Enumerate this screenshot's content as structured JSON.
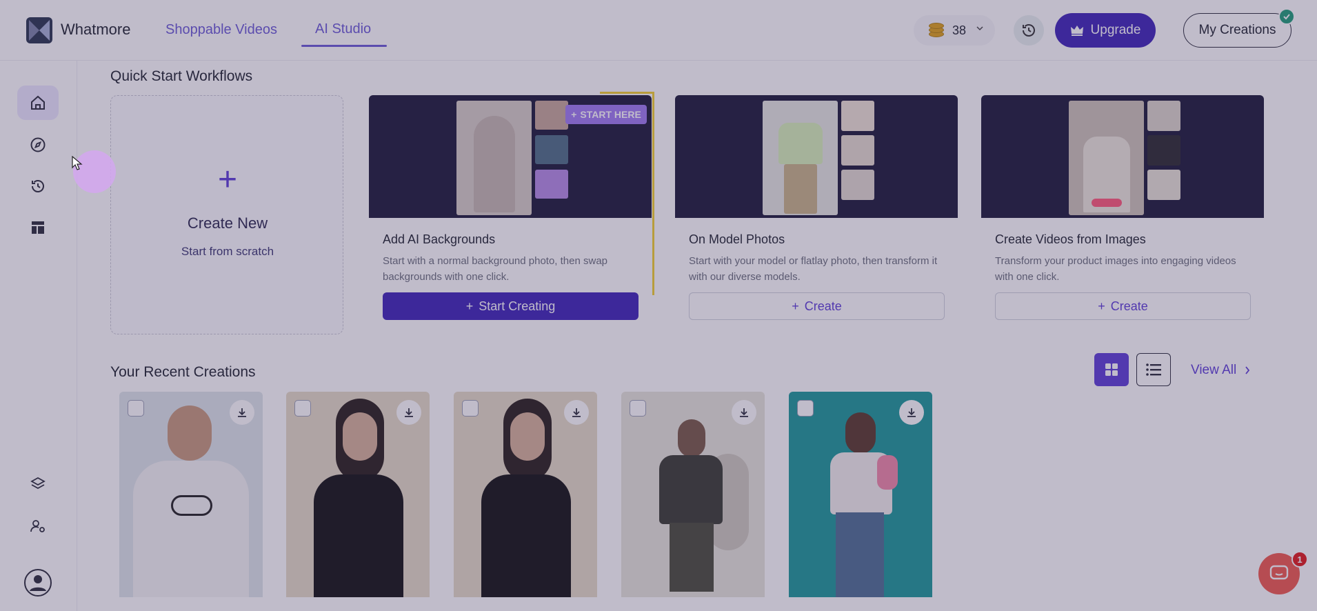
{
  "header": {
    "brand": "Whatmore",
    "nav": [
      {
        "label": "Shoppable Videos"
      },
      {
        "label": "AI Studio"
      }
    ],
    "credits": "38",
    "upgrade_label": "Upgrade",
    "my_creations_label": "My Creations"
  },
  "sidebar": {
    "items": [
      {
        "icon": "home-icon"
      },
      {
        "icon": "compass-icon"
      },
      {
        "icon": "history-icon"
      },
      {
        "icon": "templates-icon"
      },
      {
        "icon": "layers-icon"
      },
      {
        "icon": "user-settings-icon"
      },
      {
        "icon": "avatar-icon"
      }
    ]
  },
  "quick_start": {
    "title": "Quick Start Workflows",
    "create_new": {
      "title": "Create New",
      "subtitle": "Start from scratch"
    },
    "cards": [
      {
        "title": "Add AI Backgrounds",
        "description": "Start with a normal background photo, then swap backgrounds with one click.",
        "button": "Start Creating",
        "badge": "START HERE"
      },
      {
        "title": "On Model Photos",
        "description": "Start with your model or flatlay photo, then transform it with our diverse models.",
        "button": "Create"
      },
      {
        "title": "Create Videos from Images",
        "description": "Transform your product images into engaging videos with one click.",
        "button": "Create"
      }
    ]
  },
  "recent": {
    "title": "Your Recent Creations",
    "view_all": "View All",
    "items": [
      {
        "bg": "#dfe6ea",
        "top": "#f5f5f5"
      },
      {
        "bg": "#e6dcc8",
        "top": "#141414"
      },
      {
        "bg": "#e6dcc8",
        "top": "#141414"
      },
      {
        "bg": "#e8e6dc",
        "top": "#3a3d33"
      },
      {
        "bg": "#1c9a9a",
        "top": "#f3efee"
      }
    ]
  },
  "chat": {
    "badge": "1"
  },
  "colors": {
    "accent": "#3f25b8",
    "link": "#5d3fd8",
    "chat": "#f05b4e"
  }
}
